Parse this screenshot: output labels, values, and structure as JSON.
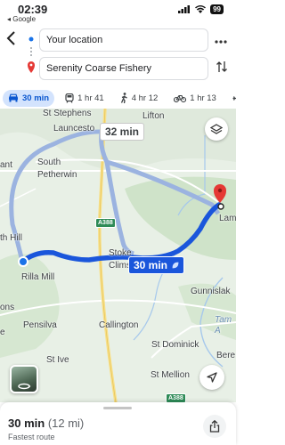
{
  "status_bar": {
    "time": "02:39",
    "back_app": "◂ Google",
    "battery": "99"
  },
  "directions": {
    "from": "Your location",
    "to": "Serenity Coarse Fishery",
    "more_icon": "more-horizontal-icon",
    "swap_icon": "swap-vertical-icon"
  },
  "modes": [
    {
      "name": "car",
      "label": "30 min",
      "active": true
    },
    {
      "name": "transit",
      "label": "1 hr 41",
      "active": false
    },
    {
      "name": "walk",
      "label": "4 hr 12",
      "active": false
    },
    {
      "name": "bike",
      "label": "1 hr 13",
      "active": false
    }
  ],
  "map": {
    "places": {
      "st_stephens": "St Stephens",
      "lifton": "Lifton",
      "launceston": "Launcesto",
      "ant": "ant",
      "south_petherwin": "South\nPetherwin",
      "th_hill": "th Hill",
      "rilla_mill": "Rilla Mill",
      "stoke_climsland": "Stoke\nClimsl",
      "lam": "Lam",
      "gunnislake": "Gunnislak",
      "tam": "Tam",
      "a": "A",
      "ons": "ons",
      "pensilva": "Pensilva",
      "callington": "Callington",
      "e": "e",
      "st_dominick": "St Dominick",
      "bere": "Bere",
      "st_ive": "St Ive",
      "st_mellion": "St Mellion"
    },
    "road_shields": [
      "A388",
      "A388"
    ],
    "alt_route_time": "32 min",
    "main_route_time": "30 min",
    "colors": {
      "route_main": "#1a56db",
      "route_alt": "#9bb3e0",
      "destination_pin": "#e53935",
      "road_a": "#f7e08a"
    }
  },
  "sheet": {
    "duration": "30 min",
    "distance": "(12 mi)",
    "note": "Fastest route"
  }
}
